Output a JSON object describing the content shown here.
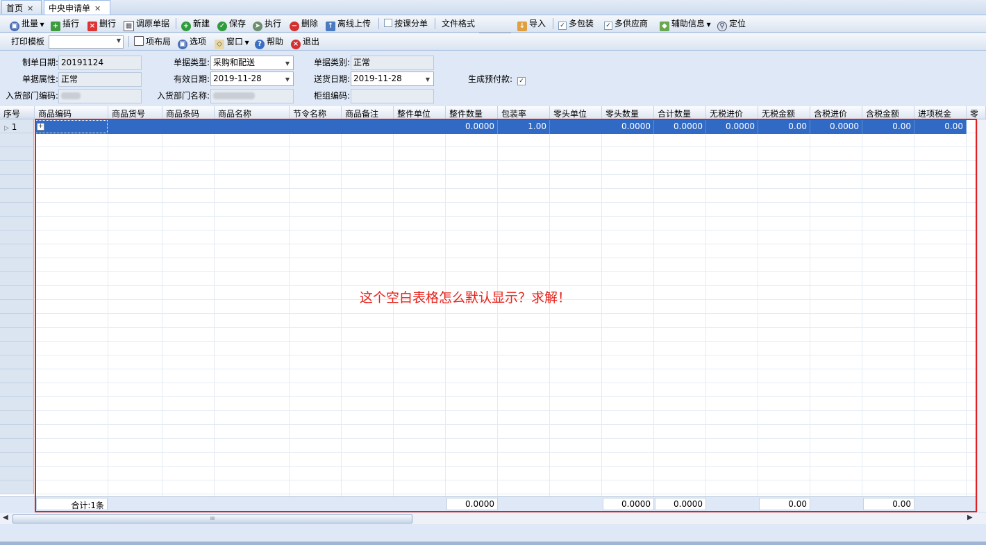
{
  "tabs": [
    {
      "label": "首页",
      "close": "✕"
    },
    {
      "label": "中央申请单",
      "close": "✕"
    }
  ],
  "toolbar1": {
    "batch": "批量",
    "insert_row": "插行",
    "delete_row": "删行",
    "restore_doc": "调原单据",
    "new": "新建",
    "save": "保存",
    "execute": "执行",
    "remove": "删除",
    "offline_upload": "离线上传",
    "split_by_section": "按课分单",
    "file_format_label": "文件格式",
    "file_format_value": "",
    "import": "导入",
    "multi_package": "多包装",
    "multi_package_checked": "✓",
    "multi_supplier": "多供应商",
    "multi_supplier_checked": "✓",
    "aux_info": "辅助信息",
    "locate": "定位"
  },
  "toolbar2": {
    "print_template_label": "打印模板",
    "print_template_value": "",
    "item_layout": "项布局",
    "options": "选项",
    "window": "窗口",
    "help": "帮助",
    "exit": "退出"
  },
  "form": {
    "create_date_label": "制单日期:",
    "create_date": "20191124",
    "doc_type_label": "单据类型:",
    "doc_type": "采购和配送",
    "doc_category_label": "单据类别:",
    "doc_category": "正常",
    "doc_attr_label": "单据属性:",
    "doc_attr": "正常",
    "valid_date_label": "有效日期:",
    "valid_date": "2019-11-28",
    "delivery_date_label": "送货日期:",
    "delivery_date": "2019-11-28",
    "gen_prepay_label": "生成预付款:",
    "gen_prepay_checked": "✓",
    "in_dept_code_label": "入货部门编码:",
    "in_dept_name_label": "入货部门名称:",
    "cabinet_code_label": "柜组编码:",
    "cabinet_code": ""
  },
  "grid": {
    "columns": [
      "序号",
      "商品编码",
      "商品货号",
      "商品条码",
      "商品名称",
      "节令名称",
      "商品备注",
      "整件单位",
      "整件数量",
      "包装率",
      "零头单位",
      "零头数量",
      "合计数量",
      "无税进价",
      "无税金额",
      "含税进价",
      "含税金额",
      "进项税金",
      "零"
    ],
    "rows": [
      {
        "seq": "1",
        "whole_qty": "0.0000",
        "pack_rate": "1.00",
        "loose_qty": "0.0000",
        "total_qty": "0.0000",
        "net_price": "0.0000",
        "net_amount": "0.00",
        "tax_price": "0.0000",
        "tax_amount": "0.00",
        "input_tax": "0.00",
        "expand": "+"
      }
    ],
    "footer": {
      "count_label": "合计:1条",
      "whole_qty": "0.0000",
      "loose_qty": "0.0000",
      "total_qty": "0.0000",
      "net_amount": "0.00",
      "tax_amount": "0.00"
    }
  },
  "annotation": "这个空白表格怎么默认显示？求解！",
  "scroll": {
    "left": "◀",
    "right": "▶",
    "grip": "III"
  },
  "colors": {
    "selection": "#316ac5",
    "annotation": "#e8211a",
    "panel": "#dfe8f6"
  }
}
